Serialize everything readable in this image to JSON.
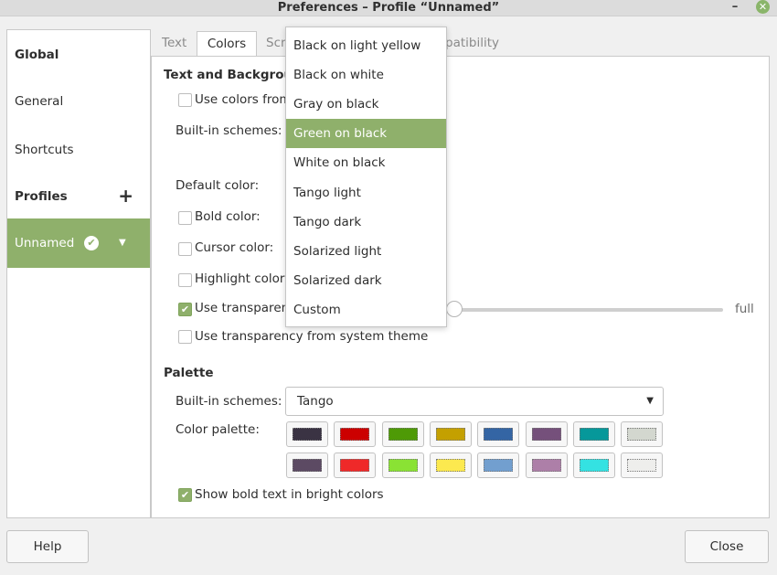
{
  "window": {
    "title": "Preferences – Profile “Unnamed”",
    "minimize_glyph": "–",
    "close_glyph": "✕"
  },
  "sidebar": {
    "global": "Global",
    "general": "General",
    "shortcuts": "Shortcuts",
    "profiles": "Profiles",
    "add_glyph": "+",
    "profile_name": "Unnamed",
    "default_glyph": "✔",
    "dropdown_glyph": "▼"
  },
  "tabs": {
    "text": "Text",
    "colors": "Colors",
    "scrolling_partial": "Scr",
    "compatibility_partial": "patibility"
  },
  "colors_tab": {
    "section_title_partial": "Text and Backgroun",
    "use_system_colors_partial": "Use colors from",
    "builtin_schemes_label": "Built-in schemes:",
    "default_color_label": "Default color:",
    "bold_color_label": "Bold color:",
    "cursor_color_label": "Cursor color:",
    "highlight_color_label": "Highlight color:",
    "use_transparent_partial": "Use transparent",
    "slider_end_label": "full",
    "slider_value": 0,
    "use_transparency_system": "Use transparency from system theme",
    "palette_title": "Palette",
    "palette_schemes_label": "Built-in schemes:",
    "palette_scheme_value": "Tango",
    "combo_arrow": "▼",
    "color_palette_label": "Color palette:",
    "show_bold_bright": "Show bold text in bright colors",
    "check_glyph": "✔"
  },
  "palette_colors": {
    "row1": [
      "#3a3343",
      "#cc0000",
      "#4e9a06",
      "#c4a000",
      "#3465a4",
      "#75507b",
      "#06989a",
      "#d3d7cf"
    ],
    "row2": [
      "#5c4a63",
      "#ef2929",
      "#8ae234",
      "#fce94f",
      "#729fcf",
      "#ad7fa8",
      "#34e2e2",
      "#eeeeec"
    ]
  },
  "scheme_menu": {
    "items": [
      "Black on light yellow",
      "Black on white",
      "Gray on black",
      "Green on black",
      "White on black",
      "Tango light",
      "Tango dark",
      "Solarized light",
      "Solarized dark",
      "Custom"
    ],
    "selected": "Green on black"
  },
  "buttons": {
    "help": "Help",
    "close": "Close"
  },
  "colors": {
    "accent": "#8fb06b"
  }
}
